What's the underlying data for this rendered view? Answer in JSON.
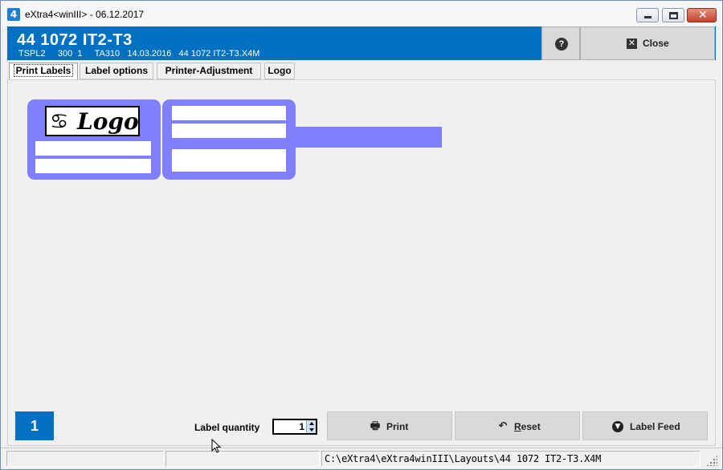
{
  "window": {
    "title": "eXtra4<winIII> - 06.12.2017",
    "app_icon_glyph": "4"
  },
  "header": {
    "title": "44 1072 IT2-T3",
    "subtitle": "TSPL2     300  1     TA310   14.03.2016   44 1072 IT2-T3.X4M",
    "help_icon": "question-circle-icon",
    "close_label": "Close",
    "color": "#0070c0"
  },
  "tabs": [
    {
      "label": "Print Labels",
      "active": true
    },
    {
      "label": "Label options",
      "active": false
    },
    {
      "label": "Printer-Adjustment",
      "active": false
    },
    {
      "label": "Logo",
      "active": false
    }
  ],
  "label_preview": {
    "logo_symbol": "♋",
    "logo_text": "Logo",
    "block_color": "#8080ff"
  },
  "page_number": "1",
  "quantity": {
    "label": "Label quantity",
    "value": "1"
  },
  "buttons": {
    "print": "Print",
    "reset_prefix": "R",
    "reset_rest": "eset",
    "feed": "Label Feed"
  },
  "statusbar": {
    "path": "C:\\eXtra4\\eXtra4winIII\\Layouts\\44 1072 IT2-T3.X4M"
  }
}
